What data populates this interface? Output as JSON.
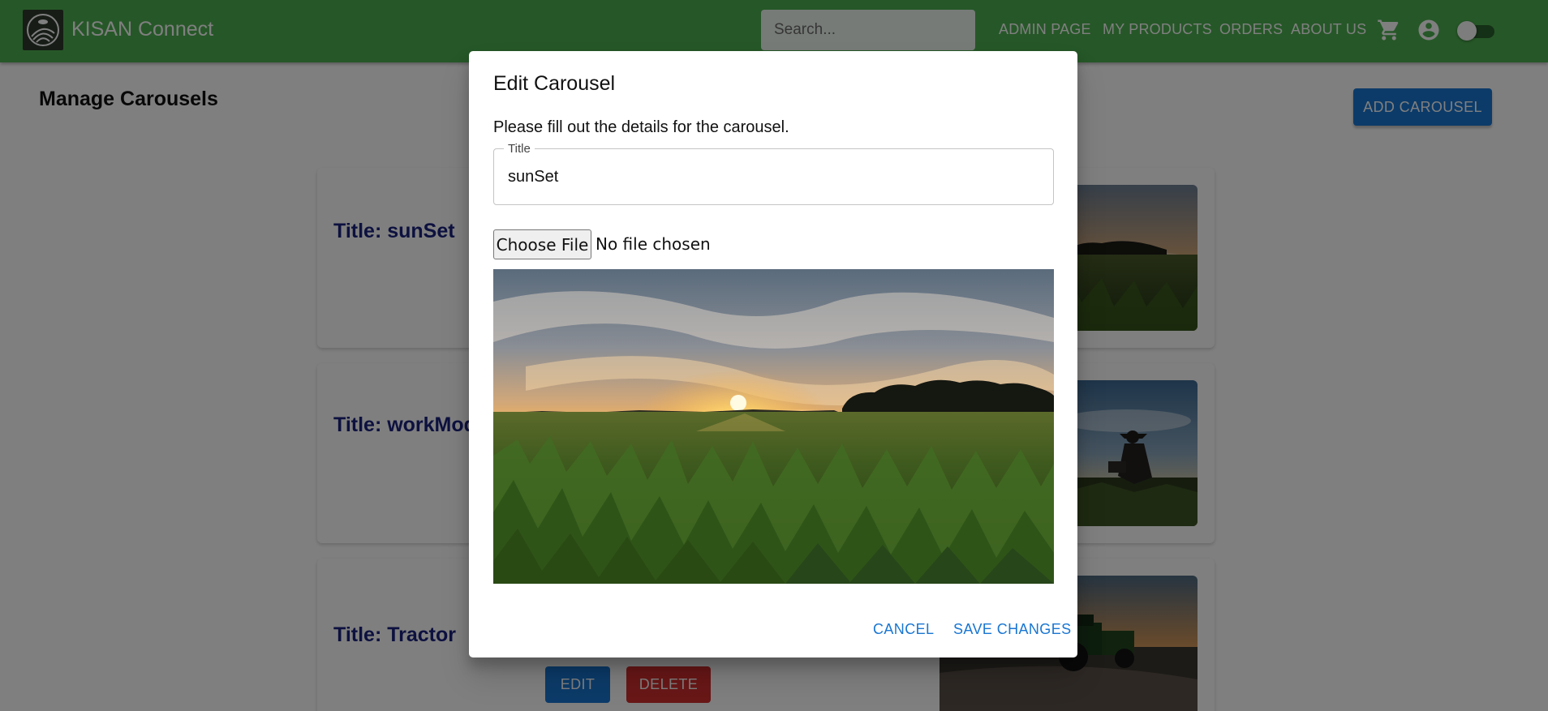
{
  "appbar": {
    "brand": "KISAN Connect",
    "search_placeholder": "Search...",
    "nav": [
      "ADMIN PAGE",
      "MY PRODUCTS",
      "ORDERS",
      "ABOUT US"
    ],
    "icons": [
      "cart-icon",
      "account-circle-icon",
      "theme-toggle"
    ],
    "color": "#4caf50"
  },
  "page": {
    "title": "Manage Carousels",
    "add_button": "ADD CAROUSEL",
    "cards": [
      {
        "title": "Title: sunSet",
        "image": "sunset-field-photo"
      },
      {
        "title": "Title: workMod",
        "image": "farmer-in-field-photo"
      },
      {
        "title": "Title: Tractor",
        "image": "tractor-sunset-photo",
        "edit_label": "EDIT",
        "delete_label": "DELETE"
      }
    ]
  },
  "dialog": {
    "title": "Edit Carousel",
    "text": "Please fill out the details for the carousel.",
    "field_label": "Title",
    "field_value": "sunSet",
    "file_button": "Choose File",
    "file_status": "No file chosen",
    "cancel": "CANCEL",
    "save": "SAVE CHANGES"
  },
  "colors": {
    "primary": "#1976d2",
    "danger": "#d32f2f",
    "card_title": "#1a237e"
  }
}
